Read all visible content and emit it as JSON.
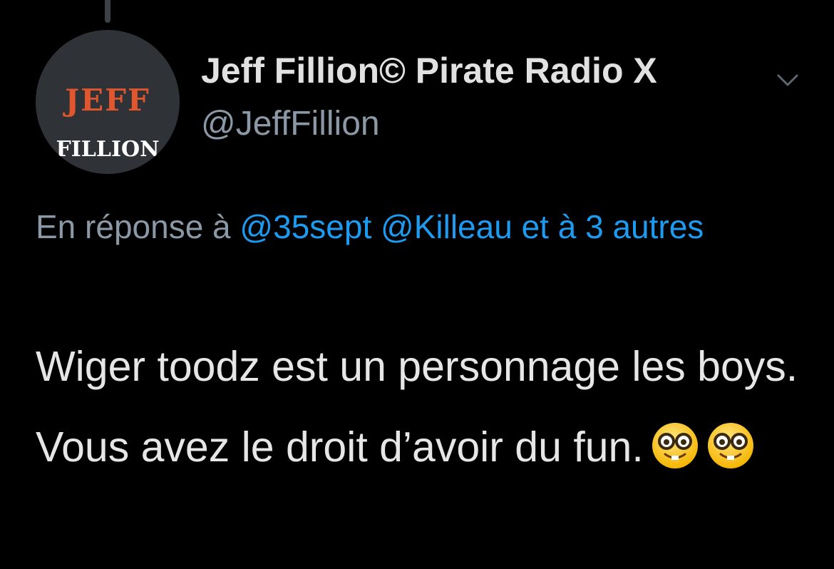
{
  "author": {
    "avatar_text_top": "JEFF",
    "avatar_text_bottom": "FILLION",
    "display_name": "Jeff Fillion© Pirate Radio X",
    "handle": "@JeffFillion"
  },
  "reply": {
    "prefix": "En réponse à ",
    "mention_1": "@35sept",
    "mention_2": "@Killeau",
    "and_others": "et à 3 autres"
  },
  "tweet": {
    "text": "Wiger toodz est un personnage les boys. Vous avez le droit d’avoir du fun.",
    "emojis": [
      "nerd-face",
      "nerd-face"
    ]
  },
  "colors": {
    "background": "#000000",
    "link": "#1d9bf0",
    "secondary_text": "#8b98a5",
    "avatar_accent": "#e2562e"
  }
}
